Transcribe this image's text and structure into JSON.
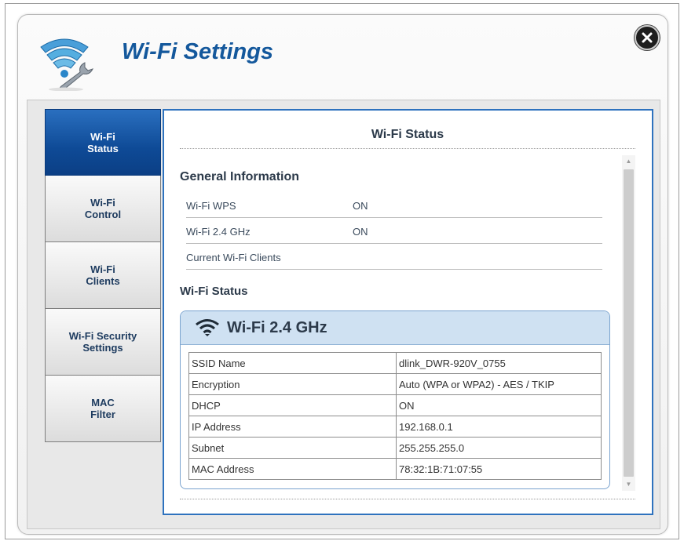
{
  "dialog": {
    "title": "Wi-Fi Settings"
  },
  "sidebar": {
    "items": [
      {
        "label": "Wi-Fi\nStatus",
        "active": true
      },
      {
        "label": "Wi-Fi\nControl",
        "active": false
      },
      {
        "label": "Wi-Fi\nClients",
        "active": false
      },
      {
        "label": "Wi-Fi Security\nSettings",
        "active": false
      },
      {
        "label": "MAC\nFilter",
        "active": false
      }
    ]
  },
  "main": {
    "title": "Wi-Fi Status",
    "general": {
      "heading": "General Information",
      "rows": [
        {
          "key": "Wi-Fi WPS",
          "value": "ON"
        },
        {
          "key": "Wi-Fi 2.4 GHz",
          "value": "ON"
        },
        {
          "key": "Current Wi-Fi Clients",
          "value": ""
        }
      ]
    },
    "status": {
      "heading": "Wi-Fi Status",
      "card_title": "Wi-Fi 2.4 GHz",
      "rows": [
        {
          "key": "SSID Name",
          "value": "dlink_DWR-920V_0755"
        },
        {
          "key": "Encryption",
          "value": "Auto (WPA or WPA2) - AES / TKIP"
        },
        {
          "key": "DHCP",
          "value": "ON"
        },
        {
          "key": "IP Address",
          "value": "192.168.0.1"
        },
        {
          "key": "Subnet",
          "value": "255.255.255.0"
        },
        {
          "key": "MAC Address",
          "value": "78:32:1B:71:07:55"
        }
      ]
    }
  },
  "icons": {
    "close": "close-icon",
    "logo": "wifi-wrench-icon",
    "card": "wifi-signal-icon",
    "scroll_up": "scroll-up-arrow-icon",
    "scroll_down": "scroll-down-arrow-icon"
  },
  "colors": {
    "accent": "#14589c",
    "panel_border": "#2e72be",
    "active_tab": "#0e4a96",
    "card_header": "#cfe1f2"
  }
}
